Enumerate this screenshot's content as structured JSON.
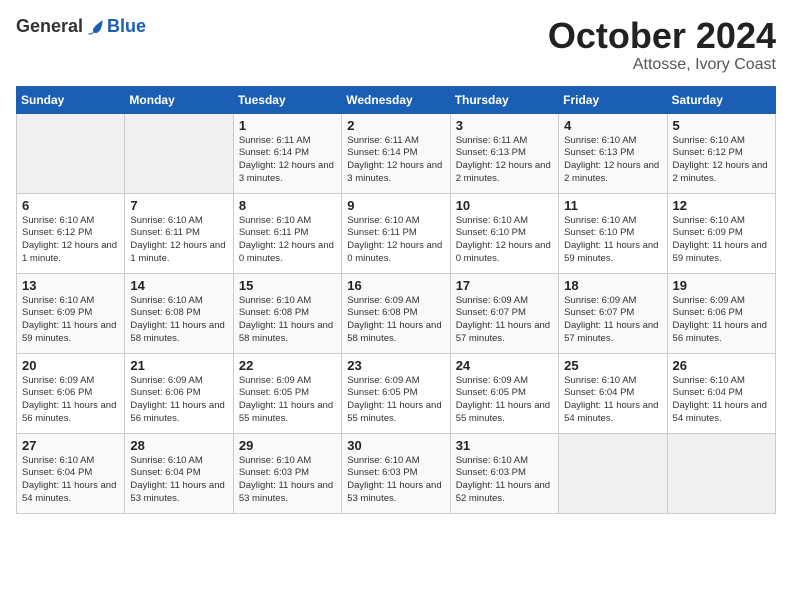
{
  "header": {
    "logo_general": "General",
    "logo_blue": "Blue",
    "month": "October 2024",
    "location": "Attosse, Ivory Coast"
  },
  "days_of_week": [
    "Sunday",
    "Monday",
    "Tuesday",
    "Wednesday",
    "Thursday",
    "Friday",
    "Saturday"
  ],
  "weeks": [
    [
      {
        "day": "",
        "empty": true
      },
      {
        "day": "",
        "empty": true
      },
      {
        "day": "1",
        "sunrise": "Sunrise: 6:11 AM",
        "sunset": "Sunset: 6:14 PM",
        "daylight": "Daylight: 12 hours and 3 minutes."
      },
      {
        "day": "2",
        "sunrise": "Sunrise: 6:11 AM",
        "sunset": "Sunset: 6:14 PM",
        "daylight": "Daylight: 12 hours and 3 minutes."
      },
      {
        "day": "3",
        "sunrise": "Sunrise: 6:11 AM",
        "sunset": "Sunset: 6:13 PM",
        "daylight": "Daylight: 12 hours and 2 minutes."
      },
      {
        "day": "4",
        "sunrise": "Sunrise: 6:10 AM",
        "sunset": "Sunset: 6:13 PM",
        "daylight": "Daylight: 12 hours and 2 minutes."
      },
      {
        "day": "5",
        "sunrise": "Sunrise: 6:10 AM",
        "sunset": "Sunset: 6:12 PM",
        "daylight": "Daylight: 12 hours and 2 minutes."
      }
    ],
    [
      {
        "day": "6",
        "sunrise": "Sunrise: 6:10 AM",
        "sunset": "Sunset: 6:12 PM",
        "daylight": "Daylight: 12 hours and 1 minute."
      },
      {
        "day": "7",
        "sunrise": "Sunrise: 6:10 AM",
        "sunset": "Sunset: 6:11 PM",
        "daylight": "Daylight: 12 hours and 1 minute."
      },
      {
        "day": "8",
        "sunrise": "Sunrise: 6:10 AM",
        "sunset": "Sunset: 6:11 PM",
        "daylight": "Daylight: 12 hours and 0 minutes."
      },
      {
        "day": "9",
        "sunrise": "Sunrise: 6:10 AM",
        "sunset": "Sunset: 6:11 PM",
        "daylight": "Daylight: 12 hours and 0 minutes."
      },
      {
        "day": "10",
        "sunrise": "Sunrise: 6:10 AM",
        "sunset": "Sunset: 6:10 PM",
        "daylight": "Daylight: 12 hours and 0 minutes."
      },
      {
        "day": "11",
        "sunrise": "Sunrise: 6:10 AM",
        "sunset": "Sunset: 6:10 PM",
        "daylight": "Daylight: 11 hours and 59 minutes."
      },
      {
        "day": "12",
        "sunrise": "Sunrise: 6:10 AM",
        "sunset": "Sunset: 6:09 PM",
        "daylight": "Daylight: 11 hours and 59 minutes."
      }
    ],
    [
      {
        "day": "13",
        "sunrise": "Sunrise: 6:10 AM",
        "sunset": "Sunset: 6:09 PM",
        "daylight": "Daylight: 11 hours and 59 minutes."
      },
      {
        "day": "14",
        "sunrise": "Sunrise: 6:10 AM",
        "sunset": "Sunset: 6:08 PM",
        "daylight": "Daylight: 11 hours and 58 minutes."
      },
      {
        "day": "15",
        "sunrise": "Sunrise: 6:10 AM",
        "sunset": "Sunset: 6:08 PM",
        "daylight": "Daylight: 11 hours and 58 minutes."
      },
      {
        "day": "16",
        "sunrise": "Sunrise: 6:09 AM",
        "sunset": "Sunset: 6:08 PM",
        "daylight": "Daylight: 11 hours and 58 minutes."
      },
      {
        "day": "17",
        "sunrise": "Sunrise: 6:09 AM",
        "sunset": "Sunset: 6:07 PM",
        "daylight": "Daylight: 11 hours and 57 minutes."
      },
      {
        "day": "18",
        "sunrise": "Sunrise: 6:09 AM",
        "sunset": "Sunset: 6:07 PM",
        "daylight": "Daylight: 11 hours and 57 minutes."
      },
      {
        "day": "19",
        "sunrise": "Sunrise: 6:09 AM",
        "sunset": "Sunset: 6:06 PM",
        "daylight": "Daylight: 11 hours and 56 minutes."
      }
    ],
    [
      {
        "day": "20",
        "sunrise": "Sunrise: 6:09 AM",
        "sunset": "Sunset: 6:06 PM",
        "daylight": "Daylight: 11 hours and 56 minutes."
      },
      {
        "day": "21",
        "sunrise": "Sunrise: 6:09 AM",
        "sunset": "Sunset: 6:06 PM",
        "daylight": "Daylight: 11 hours and 56 minutes."
      },
      {
        "day": "22",
        "sunrise": "Sunrise: 6:09 AM",
        "sunset": "Sunset: 6:05 PM",
        "daylight": "Daylight: 11 hours and 55 minutes."
      },
      {
        "day": "23",
        "sunrise": "Sunrise: 6:09 AM",
        "sunset": "Sunset: 6:05 PM",
        "daylight": "Daylight: 11 hours and 55 minutes."
      },
      {
        "day": "24",
        "sunrise": "Sunrise: 6:09 AM",
        "sunset": "Sunset: 6:05 PM",
        "daylight": "Daylight: 11 hours and 55 minutes."
      },
      {
        "day": "25",
        "sunrise": "Sunrise: 6:10 AM",
        "sunset": "Sunset: 6:04 PM",
        "daylight": "Daylight: 11 hours and 54 minutes."
      },
      {
        "day": "26",
        "sunrise": "Sunrise: 6:10 AM",
        "sunset": "Sunset: 6:04 PM",
        "daylight": "Daylight: 11 hours and 54 minutes."
      }
    ],
    [
      {
        "day": "27",
        "sunrise": "Sunrise: 6:10 AM",
        "sunset": "Sunset: 6:04 PM",
        "daylight": "Daylight: 11 hours and 54 minutes."
      },
      {
        "day": "28",
        "sunrise": "Sunrise: 6:10 AM",
        "sunset": "Sunset: 6:04 PM",
        "daylight": "Daylight: 11 hours and 53 minutes."
      },
      {
        "day": "29",
        "sunrise": "Sunrise: 6:10 AM",
        "sunset": "Sunset: 6:03 PM",
        "daylight": "Daylight: 11 hours and 53 minutes."
      },
      {
        "day": "30",
        "sunrise": "Sunrise: 6:10 AM",
        "sunset": "Sunset: 6:03 PM",
        "daylight": "Daylight: 11 hours and 53 minutes."
      },
      {
        "day": "31",
        "sunrise": "Sunrise: 6:10 AM",
        "sunset": "Sunset: 6:03 PM",
        "daylight": "Daylight: 11 hours and 52 minutes."
      },
      {
        "day": "",
        "empty": true
      },
      {
        "day": "",
        "empty": true
      }
    ]
  ]
}
